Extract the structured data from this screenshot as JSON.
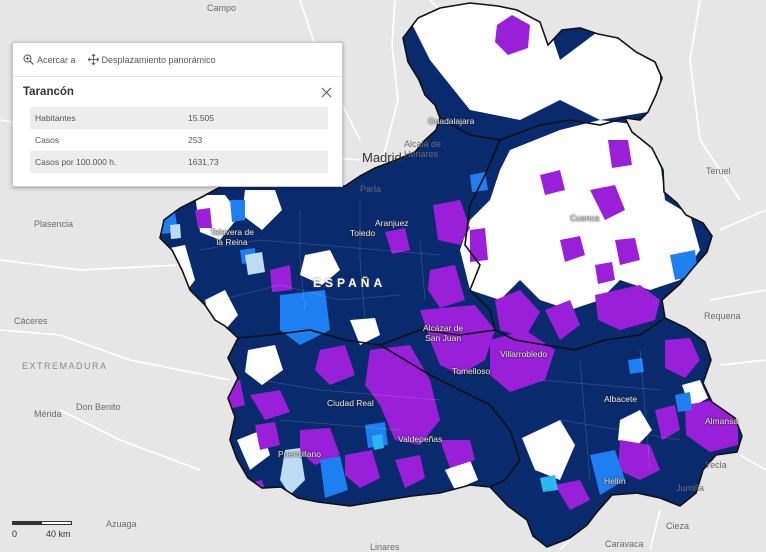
{
  "popup": {
    "zoom_label": "Acercar a",
    "pan_label": "Desplazamiento panorámico",
    "title": "Tarancón",
    "rows": [
      {
        "label": "Habitantes",
        "value": "15.505"
      },
      {
        "label": "Casos",
        "value": "253"
      },
      {
        "label": "Casos por 100.000 h.",
        "value": "1631,73"
      }
    ]
  },
  "scale": {
    "zero": "0",
    "max": "40 km"
  },
  "basemap_labels": {
    "campo": "Campo",
    "madrid": "Madrid",
    "alcala": "Alcalá de\nHenares",
    "parla": "Parla",
    "plasencia": "Plasencia",
    "caceres": "Cáceres",
    "extremadura": "EXTREMADURA",
    "merida": "Mérida",
    "don_benito": "Don Benito",
    "azuaga": "Azuaga",
    "linares": "Linares",
    "caravaca": "Caravaca",
    "cieza": "Cieza",
    "jumilla": "Jumilla",
    "yecla": "Yecla",
    "requena": "Requena",
    "teruel": "Teruel"
  },
  "map_labels": {
    "espana": "ESPAÑA",
    "guadalajara": "Guadalajara",
    "cuenca": "Cuenca",
    "toledo": "Toledo",
    "talavera": "Talavera de\nla Reina",
    "aranjuez": "Aranjuez",
    "alcazar": "Alcázar de\nSan Juan",
    "tomelloso": "Tomelloso",
    "villarrobledo": "Villarrobledo",
    "ciudad_real": "Ciudad Real",
    "valdepenas": "Valdepeñas",
    "puertollano": "Puertollano",
    "albacete": "Albacete",
    "almansa": "Almansa",
    "hellin": "Hellín"
  },
  "legend_colors": {
    "very_high": "#0a2a6e",
    "high": "#9a1fd8",
    "medium": "#1e7ff0",
    "low": "#2ab6f0",
    "very_low": "#bcdcf4",
    "none": "#ffffff",
    "boundary": "#111111",
    "background": "#e6e6e6"
  }
}
